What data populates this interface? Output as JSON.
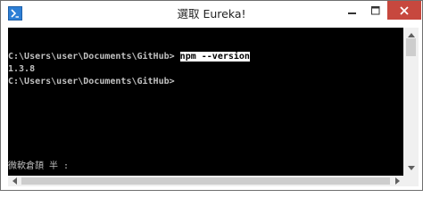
{
  "window": {
    "title": "選取 Eureka!",
    "icon": "command-prompt-icon",
    "controls": {
      "minimize": "minimize-icon",
      "maximize": "maximize-icon",
      "close": "close-icon",
      "close_color": "#c7483e"
    }
  },
  "console": {
    "background": "#000000",
    "text_color": "#c0c0c0",
    "lines": [
      {
        "prompt": "C:\\Users\\user\\Documents\\GitHub>",
        "command": "npm --version",
        "command_selected": true
      },
      {
        "text": "1.3.8"
      },
      {
        "prompt": "C:\\Users\\user\\Documents\\GitHub>"
      }
    ],
    "ime_status": "微軟倉頡 半 :"
  },
  "scrollbars": {
    "vertical": {
      "thumb_position": "top"
    },
    "horizontal": {
      "thumb_position": "left"
    }
  }
}
